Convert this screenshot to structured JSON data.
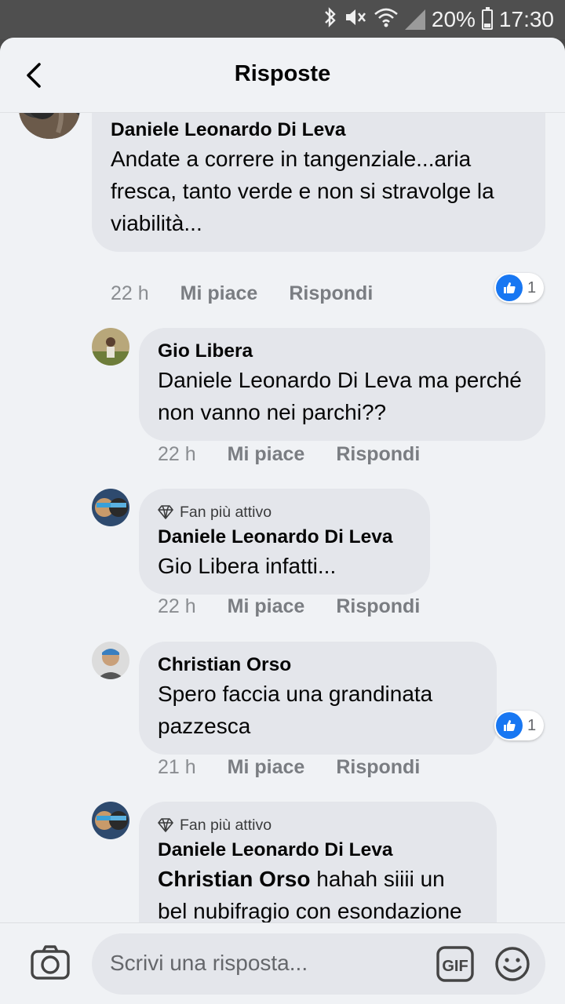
{
  "status_bar": {
    "battery": "20%",
    "time": "17:30"
  },
  "header": {
    "title": "Risposte"
  },
  "comments": [
    {
      "author": "Daniele Leonardo Di Leva",
      "text": "Andate a correre in tangenziale...aria fresca, tanto verde e non si stravolge la viabilità...",
      "time": "22 h",
      "like": "Mi piace",
      "reply": "Rispondi",
      "reactions": "1"
    },
    {
      "author": "Gio Libera",
      "text": "Daniele Leonardo Di Leva ma perché non vanno nei parchi??",
      "time": "22 h",
      "like": "Mi piace",
      "reply": "Rispondi"
    },
    {
      "badge": "Fan più attivo",
      "author": "Daniele Leonardo Di Leva",
      "text": "Gio Libera infatti...",
      "time": "22 h",
      "like": "Mi piace",
      "reply": "Rispondi"
    },
    {
      "author": "Christian Orso",
      "text": "Spero faccia una grandinata pazzesca",
      "time": "21 h",
      "like": "Mi piace",
      "reply": "Rispondi",
      "reactions": "1"
    },
    {
      "badge": "Fan più attivo",
      "author": "Daniele Leonardo Di Leva",
      "mention": "Christian Orso",
      "text": " hahah siiii un bel nubifragio con esondazione del Po, e via..."
    }
  ],
  "composer": {
    "placeholder": "Scrivi una risposta...",
    "gif_label": "GIF"
  },
  "icons": [
    "back-arrow-icon",
    "camera-icon",
    "gif-icon",
    "emoji-icon",
    "like-icon",
    "diamond-icon",
    "bluetooth-icon",
    "mute-icon",
    "wifi-icon",
    "signal-icon",
    "battery-icon"
  ],
  "colors": {
    "like_blue": "#1877f2",
    "bubble": "#e4e6eb",
    "background": "#f0f2f5"
  }
}
